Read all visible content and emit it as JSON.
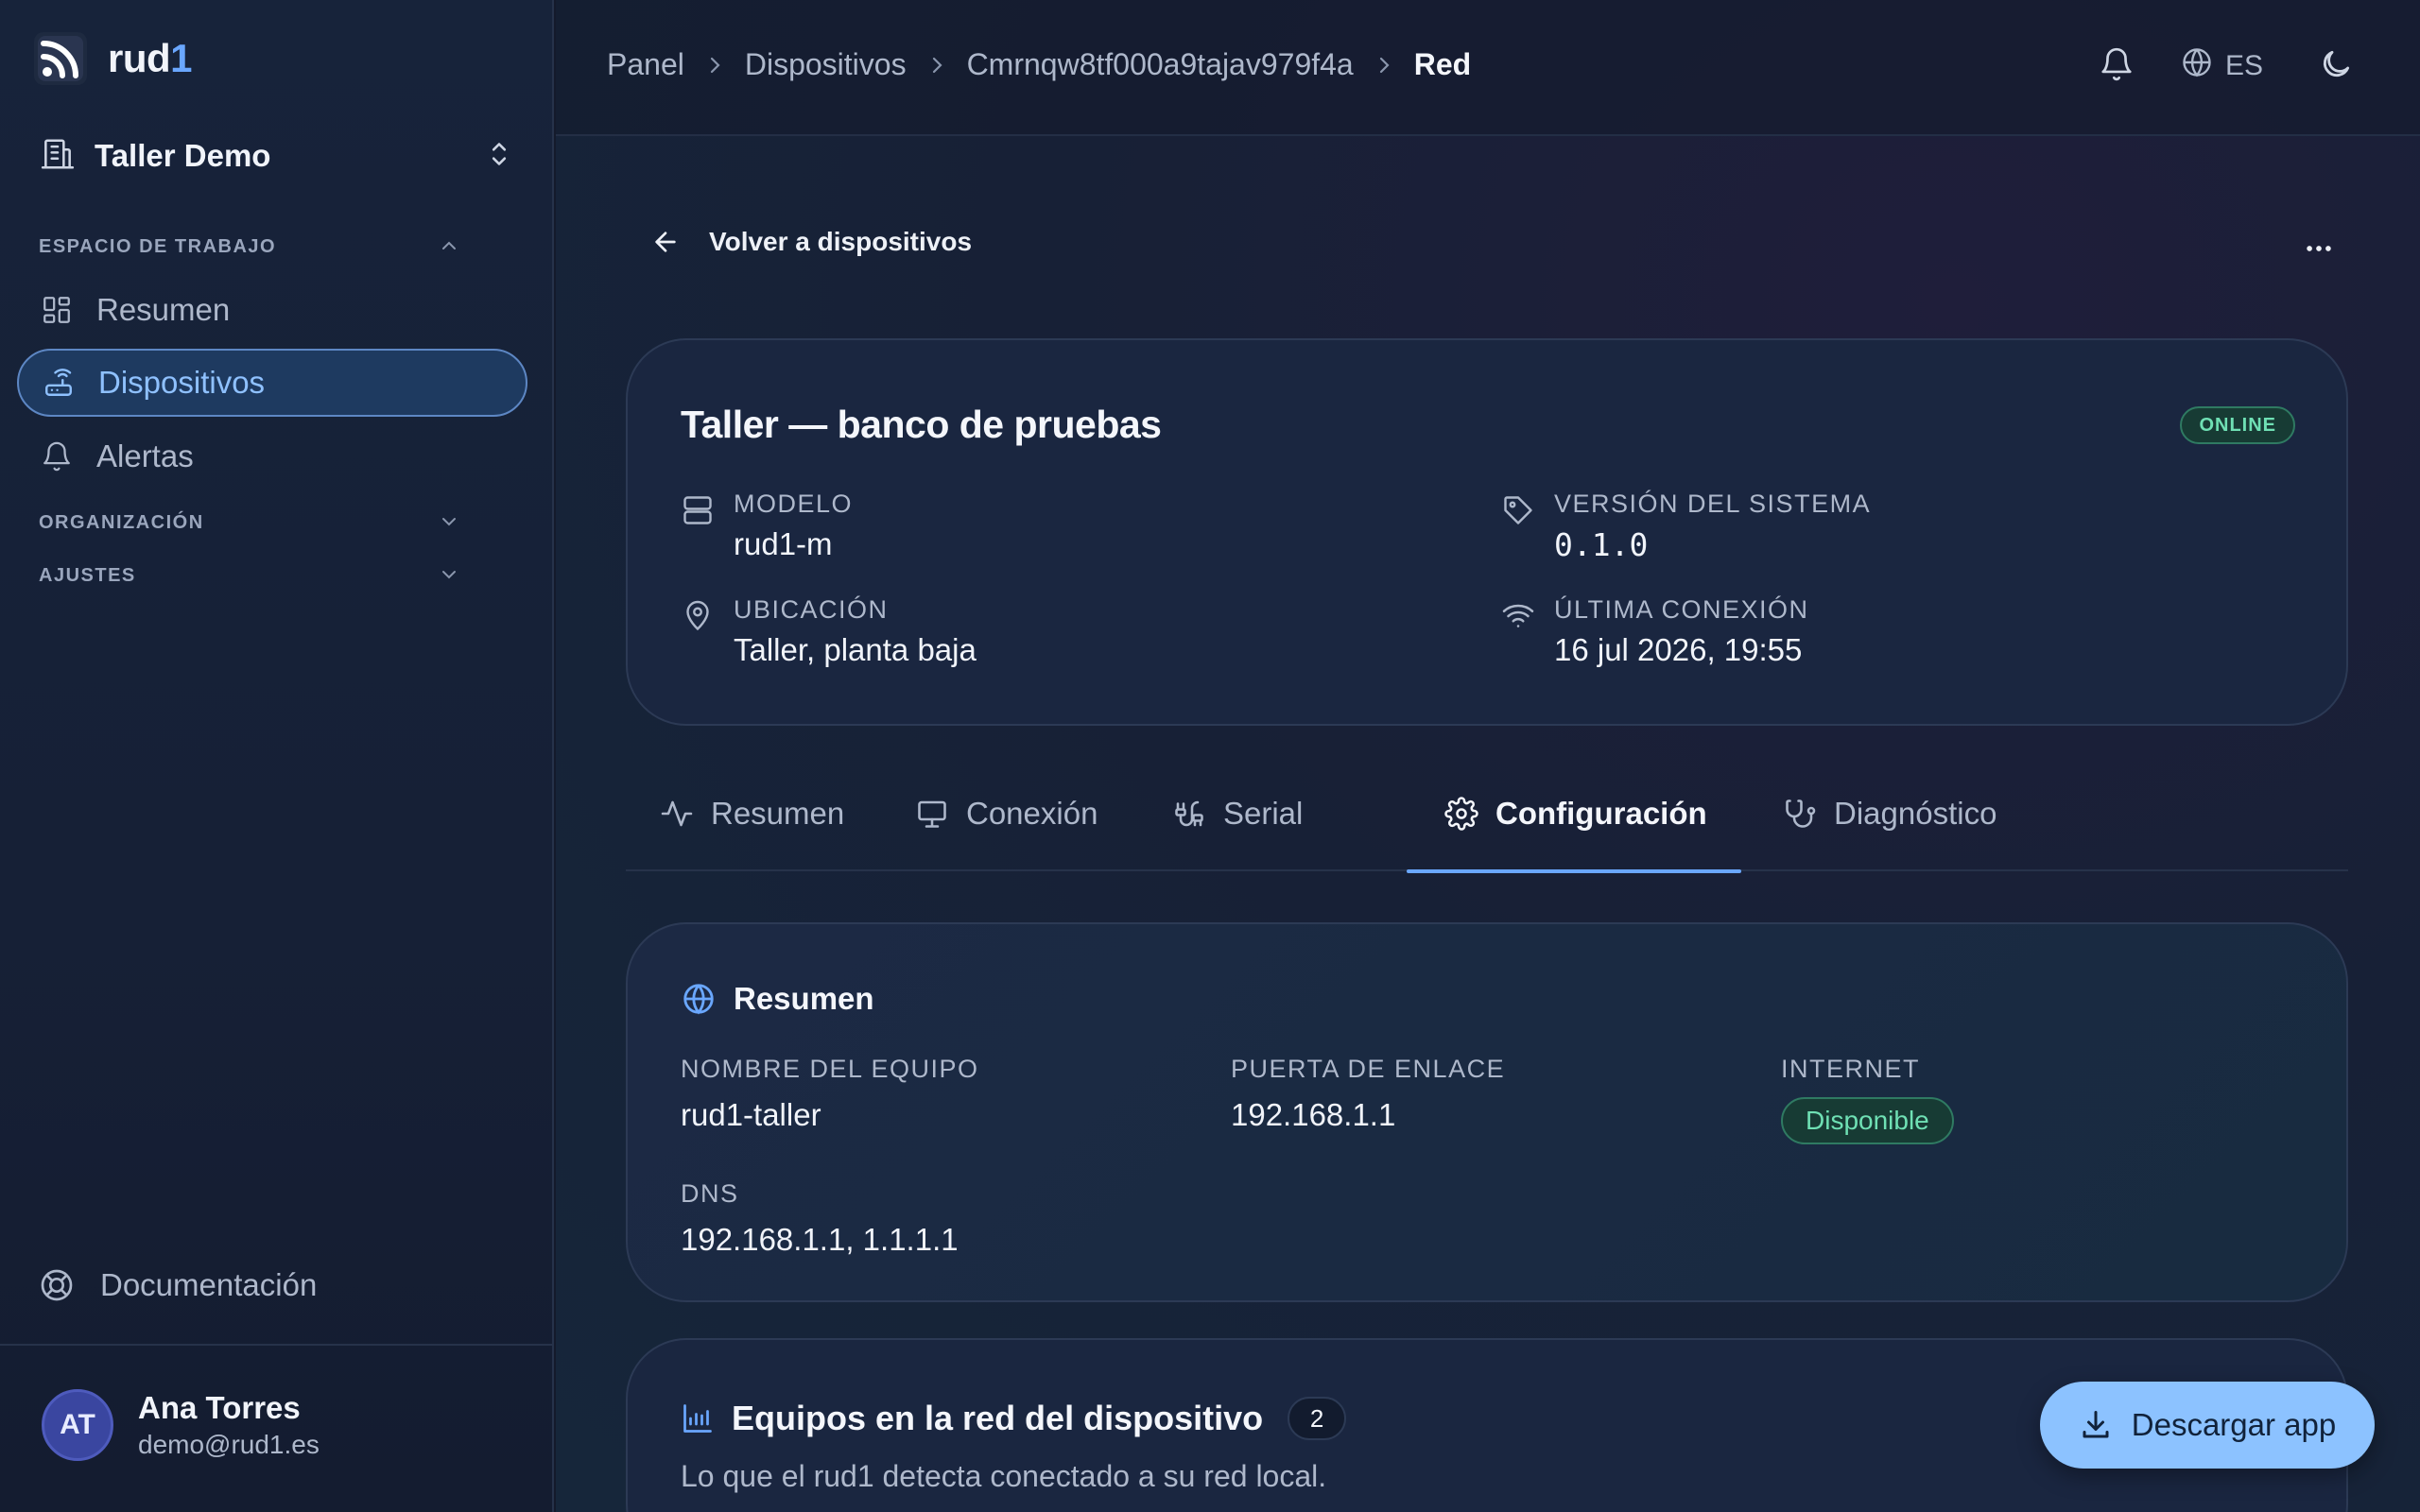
{
  "brand": {
    "name_main": "rud",
    "name_accent": "1"
  },
  "org": {
    "name": "Taller Demo"
  },
  "sidebar": {
    "sections": {
      "workspace": "ESPACIO DE TRABAJO",
      "organization": "ORGANIZACIÓN",
      "settings": "AJUSTES"
    },
    "items": [
      {
        "label": "Resumen",
        "icon": "grid-icon"
      },
      {
        "label": "Dispositivos",
        "icon": "router-icon"
      },
      {
        "label": "Alertas",
        "icon": "bell-icon"
      }
    ],
    "docs": "Documentación"
  },
  "user": {
    "initials": "AT",
    "name": "Ana Torres",
    "email": "demo@rud1.es"
  },
  "breadcrumb": [
    "Panel",
    "Dispositivos",
    "Cmrnqw8tf000a9tajav979f4a",
    "Red"
  ],
  "topbar": {
    "lang": "ES"
  },
  "back_label": "Volver a dispositivos",
  "device": {
    "title": "Taller — banco de pruebas",
    "status": "ONLINE",
    "model_label": "MODELO",
    "model": "rud1-m",
    "version_label": "VERSIÓN DEL SISTEMA",
    "version": "0.1.0",
    "location_label": "UBICACIÓN",
    "location": "Taller, planta baja",
    "last_conn_label": "ÚLTIMA CONEXIÓN",
    "last_conn": "16 jul 2026, 19:55"
  },
  "tabs": [
    {
      "label": "Resumen",
      "icon": "activity-icon"
    },
    {
      "label": "Conexión",
      "icon": "monitor-icon"
    },
    {
      "label": "Serial",
      "icon": "cable-icon"
    },
    {
      "label": "Configuración",
      "icon": "gear-icon",
      "active": true
    },
    {
      "label": "Diagnóstico",
      "icon": "stethoscope-icon"
    }
  ],
  "network": {
    "title": "Resumen",
    "hostname_label": "NOMBRE DEL EQUIPO",
    "hostname": "rud1-taller",
    "gateway_label": "PUERTA DE ENLACE",
    "gateway": "192.168.1.1",
    "internet_label": "INTERNET",
    "internet": "Disponible",
    "dns_label": "DNS",
    "dns": "192.168.1.1, 1.1.1.1"
  },
  "equipment": {
    "title": "Equipos en la red del dispositivo",
    "count": "2",
    "subtitle": "Lo que el rud1 detecta conectado a su red local."
  },
  "download_label": "Descargar app",
  "colors": {
    "accent": "#6aa7ff",
    "success": "#6fe0b4",
    "background": "#141a2b"
  }
}
